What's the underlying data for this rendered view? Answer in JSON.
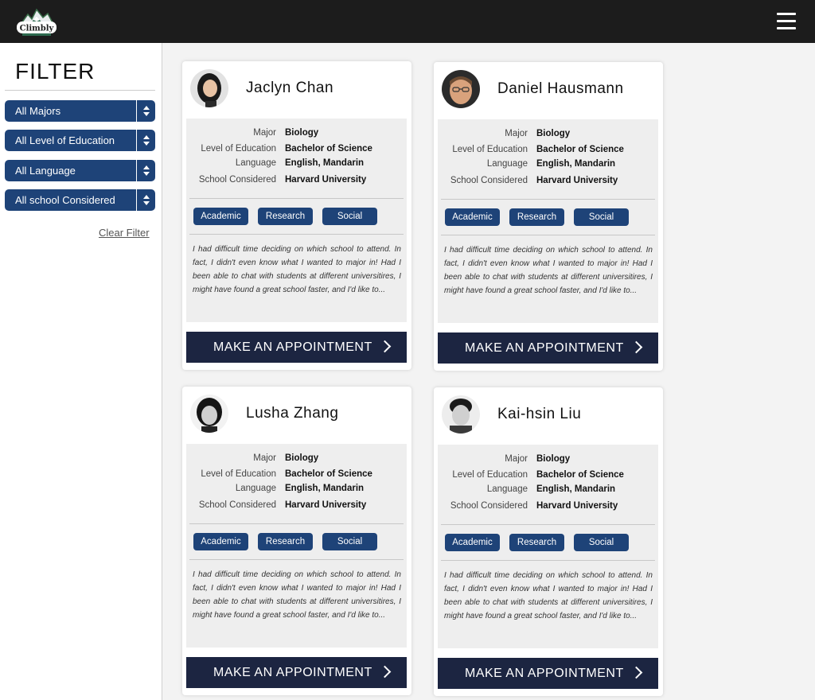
{
  "header": {
    "logo_text": "Climbly"
  },
  "sidebar": {
    "title": "FILTER",
    "selects": [
      {
        "value": "All Majors"
      },
      {
        "value": "All Level of Education"
      },
      {
        "value": "All Language"
      },
      {
        "value": "All school Considered"
      }
    ],
    "clear_label": "Clear Filter"
  },
  "labels": {
    "major": "Major",
    "level": "Level of Education",
    "language": "Language",
    "school": "School Considered",
    "button": "MAKE AN APPOINTMENT"
  },
  "cards": [
    {
      "name": "Jaclyn Chan",
      "major": "Biology",
      "level": "Bachelor of Science",
      "language": "English, Mandarin",
      "school": "Harvard University",
      "tags": [
        "Academic",
        "Research",
        "Social"
      ],
      "description": "I had difficult time deciding on which school to attend. In fact, I didn't even know what I wanted to major in! Had I been able to chat with students at different universitires, I might have found a great school faster, and I'd like to..."
    },
    {
      "name": "Daniel Hausmann",
      "major": "Biology",
      "level": "Bachelor of Science",
      "language": "English, Mandarin",
      "school": "Harvard University",
      "tags": [
        "Academic",
        "Research",
        "Social"
      ],
      "description": "I had difficult time deciding on which school to attend. In fact, I didn't even know what I wanted to major in! Had I been able to chat with students at different universitires, I might have found a great school faster, and I'd like to..."
    },
    {
      "name": "Lusha Zhang",
      "major": "Biology",
      "level": "Bachelor of Science",
      "language": "English, Mandarin",
      "school": "Harvard University",
      "tags": [
        "Academic",
        "Research",
        "Social"
      ],
      "description": "I had difficult time deciding on which school to attend. In fact, I didn't even know what I wanted to major in! Had I been able to chat with students at different universitires, I might have found a great school faster, and I'd like to..."
    },
    {
      "name": "Kai-hsin Liu",
      "major": "Biology",
      "level": "Bachelor of Science",
      "language": "English, Mandarin",
      "school": "Harvard University",
      "tags": [
        "Academic",
        "Research",
        "Social"
      ],
      "description": "I had difficult time deciding on which school to attend. In fact, I didn't even know what I wanted to major in! Had I been able to chat with students at different universitires, I might have found a great school faster, and I'd like to..."
    }
  ],
  "colors": {
    "accent": "#1e4378",
    "button": "#1c2541",
    "topbar": "#1c1c1c"
  }
}
